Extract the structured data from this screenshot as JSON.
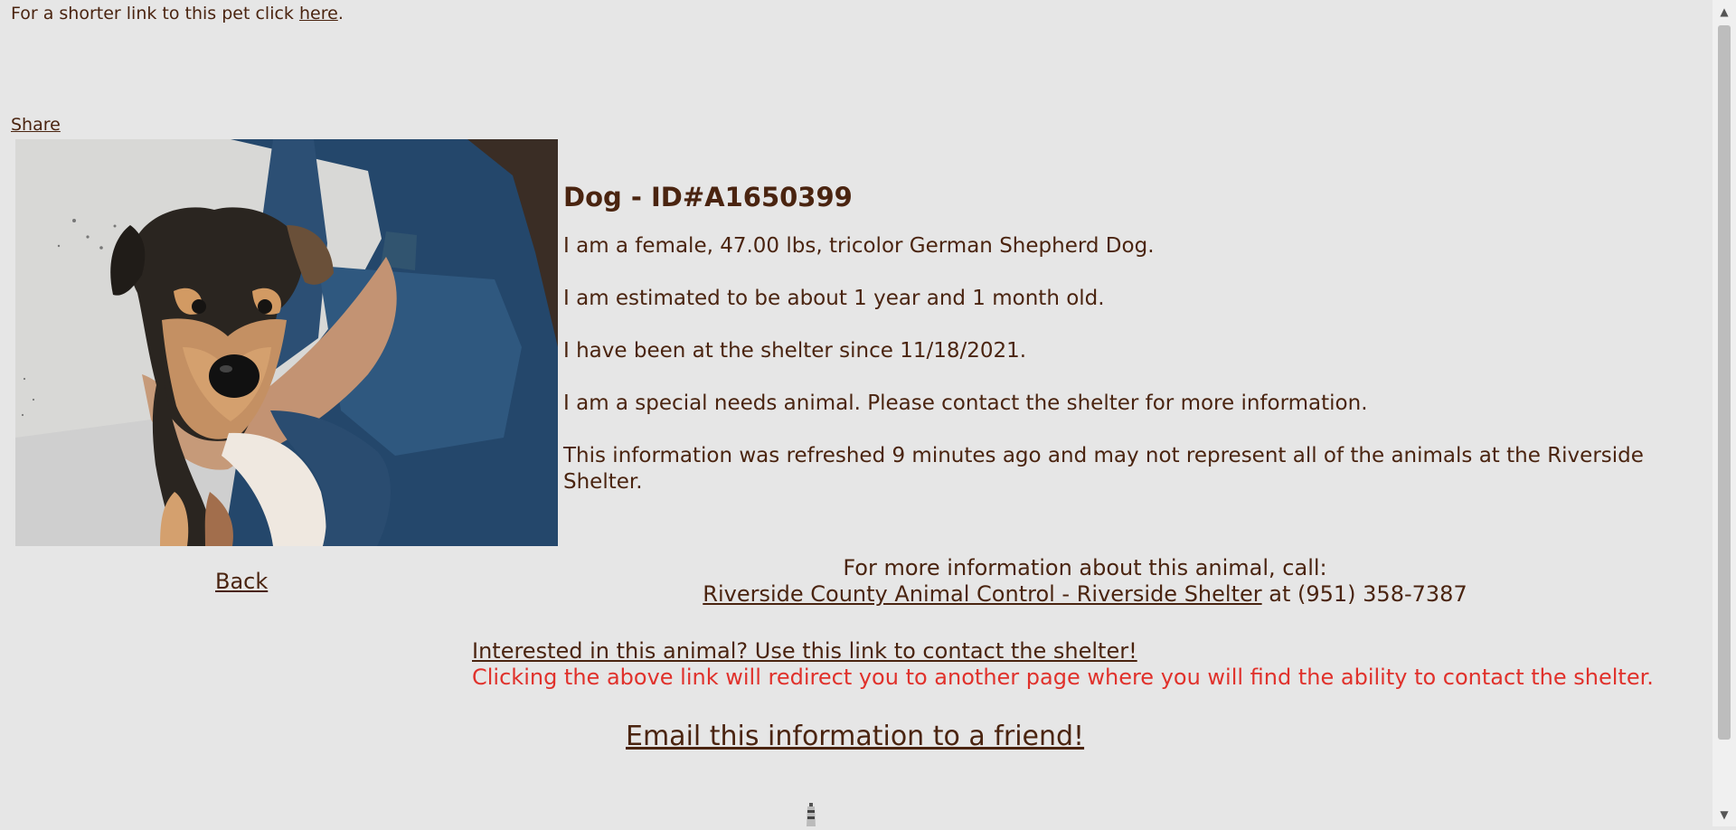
{
  "top_link": {
    "prefix": "For a shorter link to this pet click ",
    "link_text": "here",
    "suffix": "."
  },
  "share_label": "Share",
  "photo": {
    "icon": "dog-photo"
  },
  "animal": {
    "heading": "Dog - ID#A1650399",
    "description": "I am a female, 47.00 lbs, tricolor German Shepherd Dog.",
    "age": "I am estimated to be about 1 year and 1 month old.",
    "since": "I have been at the shelter since 11/18/2021.",
    "special_needs": "I am a special needs animal. Please contact the shelter for more information.",
    "refresh": "This information was refreshed 9 minutes ago and may not represent all of the animals at the Riverside Shelter."
  },
  "back_label": "Back",
  "contact": {
    "line1": "For more information about this animal, call:",
    "shelter_link": "Riverside County Animal Control - Riverside Shelter",
    "phone_text": " at (951) 358-7387"
  },
  "interest": {
    "link_text": "Interested in this animal? Use this link to contact the shelter!",
    "warning": "Clicking the above link will redirect you to another page where you will find the ability to contact the shelter."
  },
  "email_friend_label": "Email this information to a friend!",
  "colors": {
    "background": "#e6e6e6",
    "text": "#4a2410",
    "warning": "#e0312b"
  }
}
